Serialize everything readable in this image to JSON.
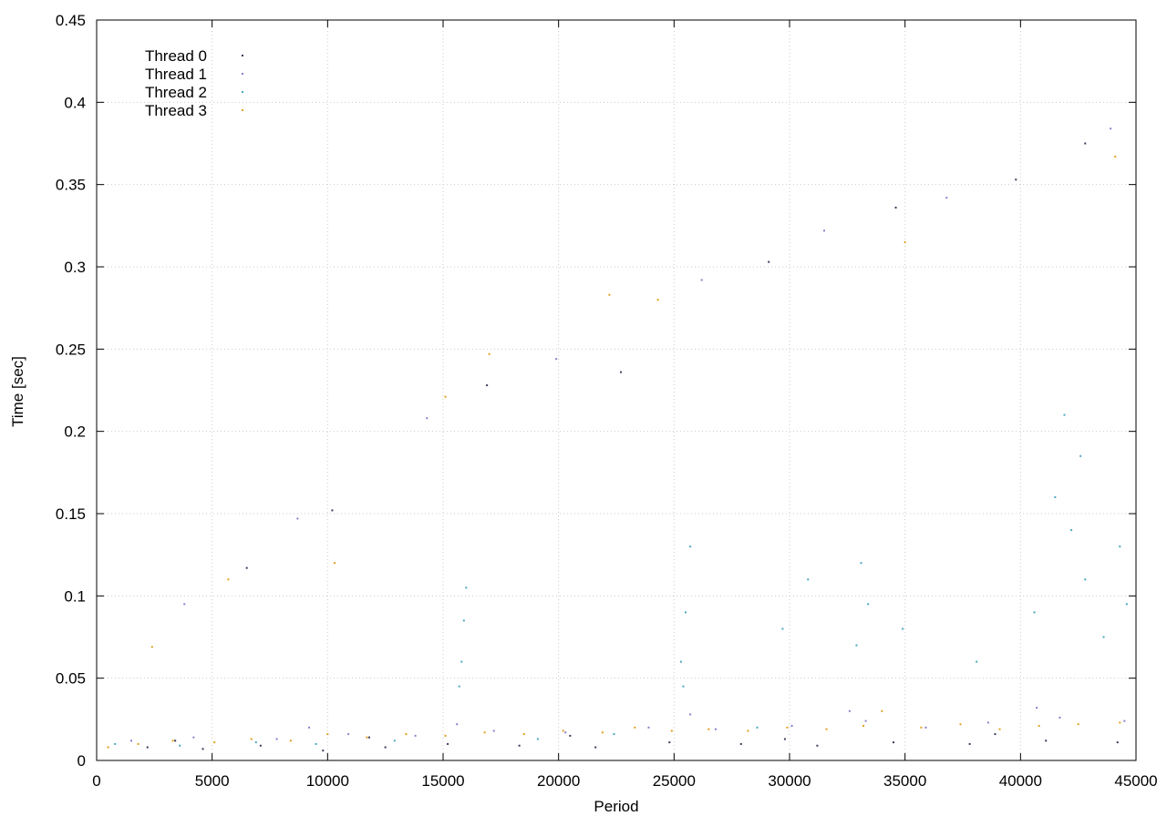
{
  "chart_data": {
    "type": "scatter",
    "title": "",
    "xlabel": "Period",
    "ylabel": "Time [sec]",
    "xlim": [
      0,
      45000
    ],
    "ylim": [
      0,
      0.45
    ],
    "xticks": [
      0,
      5000,
      10000,
      15000,
      20000,
      25000,
      30000,
      35000,
      40000,
      45000
    ],
    "yticks": [
      0,
      0.05,
      0.1,
      0.15,
      0.2,
      0.25,
      0.3,
      0.35,
      0.4,
      0.45
    ],
    "xtick_labels": [
      "0",
      "5000",
      "10000",
      "15000",
      "20000",
      "25000",
      "30000",
      "35000",
      "40000",
      "45000"
    ],
    "ytick_labels": [
      "0",
      "0.05",
      "0.1",
      "0.15",
      "0.2",
      "0.25",
      "0.3",
      "0.35",
      "0.4",
      "0.45"
    ],
    "grid": true,
    "legend_position": "top-left",
    "series": [
      {
        "name": "Thread 0",
        "color": "#3a3a5c",
        "marker": "dot",
        "points": [
          [
            2200,
            0.008
          ],
          [
            4600,
            0.007
          ],
          [
            7100,
            0.009
          ],
          [
            9800,
            0.006
          ],
          [
            12500,
            0.008
          ],
          [
            15200,
            0.01
          ],
          [
            18300,
            0.009
          ],
          [
            21600,
            0.008
          ],
          [
            24800,
            0.011
          ],
          [
            27900,
            0.01
          ],
          [
            31200,
            0.009
          ],
          [
            34500,
            0.011
          ],
          [
            37800,
            0.01
          ],
          [
            41100,
            0.012
          ],
          [
            44200,
            0.011
          ],
          [
            3400,
            0.012
          ],
          [
            11800,
            0.014
          ],
          [
            20500,
            0.015
          ],
          [
            29800,
            0.013
          ],
          [
            38900,
            0.016
          ],
          [
            6500,
            0.117
          ],
          [
            10200,
            0.152
          ],
          [
            16900,
            0.228
          ],
          [
            22700,
            0.236
          ],
          [
            29100,
            0.303
          ],
          [
            34600,
            0.336
          ],
          [
            39800,
            0.353
          ],
          [
            42800,
            0.375
          ]
        ]
      },
      {
        "name": "Thread 1",
        "color": "#8a7fd0",
        "marker": "dot",
        "points": [
          [
            1500,
            0.012
          ],
          [
            4200,
            0.014
          ],
          [
            7800,
            0.013
          ],
          [
            10900,
            0.016
          ],
          [
            13800,
            0.015
          ],
          [
            17200,
            0.018
          ],
          [
            20300,
            0.017
          ],
          [
            23900,
            0.02
          ],
          [
            26800,
            0.019
          ],
          [
            30100,
            0.021
          ],
          [
            33300,
            0.024
          ],
          [
            35900,
            0.02
          ],
          [
            38600,
            0.023
          ],
          [
            41700,
            0.026
          ],
          [
            44500,
            0.024
          ],
          [
            9200,
            0.02
          ],
          [
            15600,
            0.022
          ],
          [
            25700,
            0.028
          ],
          [
            32600,
            0.03
          ],
          [
            40700,
            0.032
          ],
          [
            3800,
            0.095
          ],
          [
            8700,
            0.147
          ],
          [
            14300,
            0.208
          ],
          [
            19900,
            0.244
          ],
          [
            26200,
            0.292
          ],
          [
            31500,
            0.322
          ],
          [
            36800,
            0.342
          ],
          [
            43900,
            0.384
          ]
        ]
      },
      {
        "name": "Thread 2",
        "color": "#4aa8c0",
        "marker": "dot",
        "points": [
          [
            800,
            0.01
          ],
          [
            3600,
            0.009
          ],
          [
            6900,
            0.011
          ],
          [
            9500,
            0.01
          ],
          [
            12900,
            0.012
          ],
          [
            15800,
            0.06
          ],
          [
            15900,
            0.085
          ],
          [
            16000,
            0.105
          ],
          [
            15700,
            0.045
          ],
          [
            19100,
            0.013
          ],
          [
            22400,
            0.016
          ],
          [
            25300,
            0.06
          ],
          [
            25500,
            0.09
          ],
          [
            25700,
            0.13
          ],
          [
            25400,
            0.045
          ],
          [
            28600,
            0.02
          ],
          [
            29700,
            0.08
          ],
          [
            30800,
            0.11
          ],
          [
            32900,
            0.07
          ],
          [
            33100,
            0.12
          ],
          [
            33400,
            0.095
          ],
          [
            34900,
            0.08
          ],
          [
            38100,
            0.06
          ],
          [
            40600,
            0.09
          ],
          [
            41500,
            0.16
          ],
          [
            42200,
            0.14
          ],
          [
            42800,
            0.11
          ],
          [
            43600,
            0.075
          ],
          [
            44300,
            0.13
          ],
          [
            44600,
            0.095
          ],
          [
            41900,
            0.21
          ],
          [
            42600,
            0.185
          ]
        ]
      },
      {
        "name": "Thread 3",
        "color": "#e0a020",
        "marker": "dot",
        "points": [
          [
            500,
            0.008
          ],
          [
            1800,
            0.01
          ],
          [
            3300,
            0.012
          ],
          [
            5100,
            0.011
          ],
          [
            6700,
            0.013
          ],
          [
            8400,
            0.012
          ],
          [
            10000,
            0.016
          ],
          [
            11700,
            0.014
          ],
          [
            13400,
            0.016
          ],
          [
            15100,
            0.015
          ],
          [
            16800,
            0.017
          ],
          [
            18500,
            0.016
          ],
          [
            20200,
            0.018
          ],
          [
            21900,
            0.017
          ],
          [
            23300,
            0.02
          ],
          [
            24900,
            0.018
          ],
          [
            26500,
            0.019
          ],
          [
            28200,
            0.018
          ],
          [
            29900,
            0.02
          ],
          [
            31600,
            0.019
          ],
          [
            33200,
            0.021
          ],
          [
            34000,
            0.03
          ],
          [
            35700,
            0.02
          ],
          [
            37400,
            0.022
          ],
          [
            39100,
            0.019
          ],
          [
            40800,
            0.021
          ],
          [
            42500,
            0.022
          ],
          [
            44300,
            0.023
          ],
          [
            2400,
            0.069
          ],
          [
            5700,
            0.11
          ],
          [
            10300,
            0.12
          ],
          [
            15100,
            0.221
          ],
          [
            17000,
            0.247
          ],
          [
            22200,
            0.283
          ],
          [
            24300,
            0.28
          ],
          [
            35000,
            0.315
          ],
          [
            44100,
            0.367
          ]
        ]
      }
    ]
  }
}
